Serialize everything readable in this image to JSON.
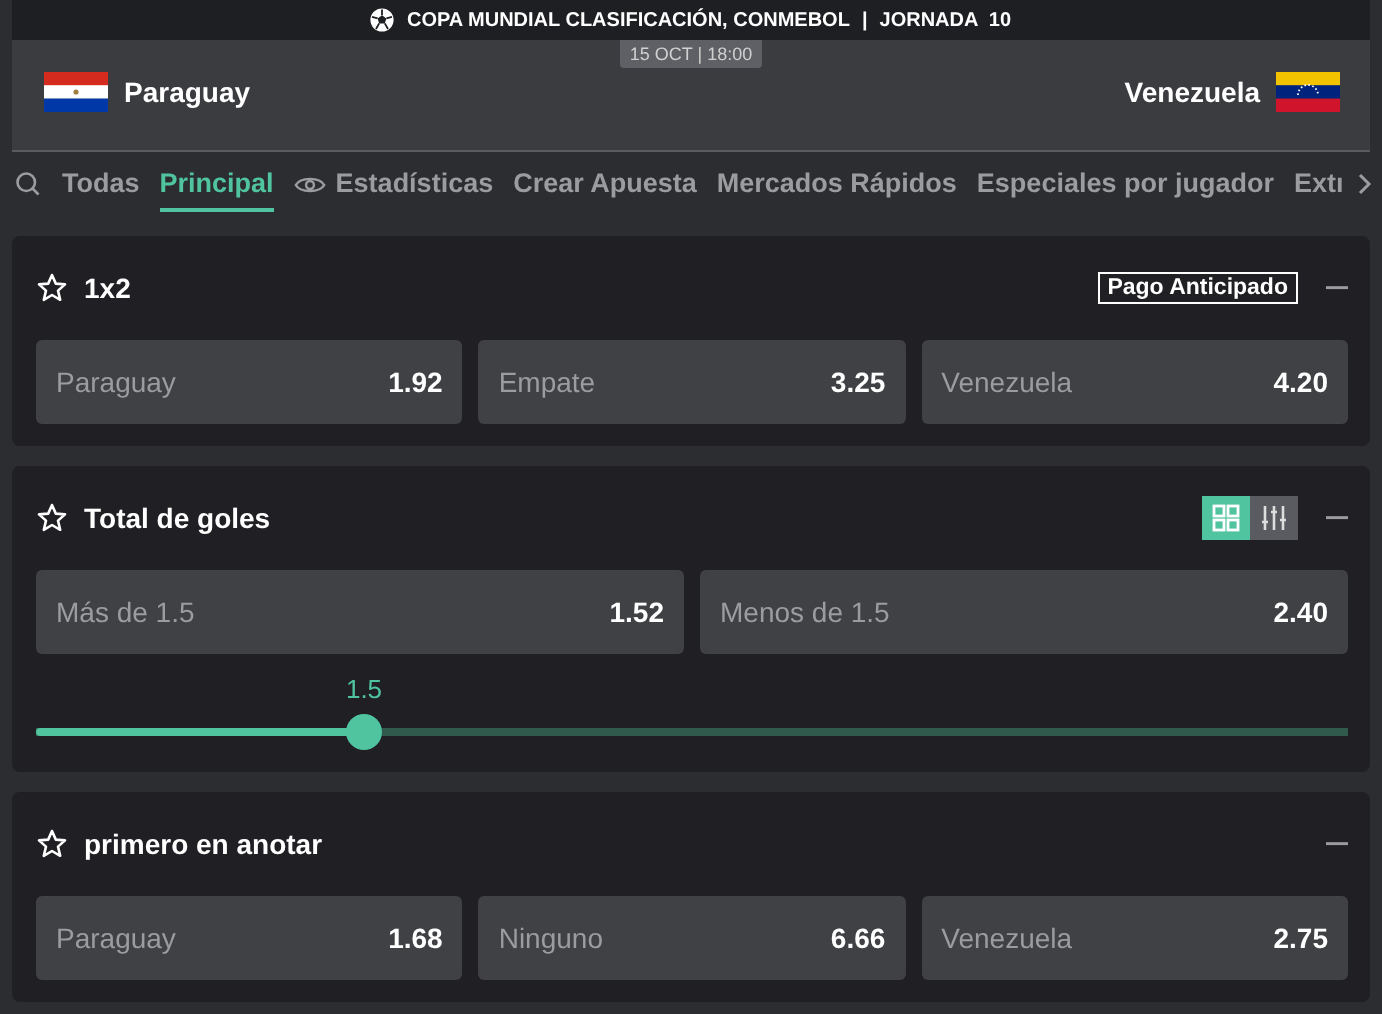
{
  "event": {
    "competition": "COPA MUNDIAL CLASIFICACIÓN, CONMEBOL",
    "separator": "|",
    "round": "JORNADA  10",
    "datetime": "15 OCT | 18:00",
    "home": "Paraguay",
    "away": "Venezuela"
  },
  "tabs": [
    {
      "label": "Todas",
      "selected": false,
      "kind": "plain"
    },
    {
      "label": "Principal",
      "selected": true,
      "kind": "plain"
    },
    {
      "label": "Estadísticas",
      "selected": false,
      "kind": "eye"
    },
    {
      "label": "Crear Apuesta",
      "selected": false,
      "kind": "plain"
    },
    {
      "label": "Mercados Rápidos",
      "selected": false,
      "kind": "plain"
    },
    {
      "label": "Especiales por jugador",
      "selected": false,
      "kind": "plain"
    },
    {
      "label": "Extı",
      "selected": false,
      "kind": "plain"
    }
  ],
  "markets": [
    {
      "title": "1x2",
      "badge": "Pago Anticipado",
      "odds": [
        {
          "label": "Paraguay",
          "price": "1.92"
        },
        {
          "label": "Empate",
          "price": "3.25"
        },
        {
          "label": "Venezuela",
          "price": "4.20"
        }
      ]
    },
    {
      "title": "Total de goles",
      "views": [
        {
          "kind": "grid",
          "selected": true
        },
        {
          "kind": "sliders",
          "selected": false
        }
      ],
      "odds": [
        {
          "label": "Más de 1.5",
          "price": "1.52"
        },
        {
          "label": "Menos de 1.5",
          "price": "2.40"
        }
      ],
      "slider": {
        "reading": "1.5",
        "level": 0.25
      }
    },
    {
      "title": "primero en anotar",
      "odds": [
        {
          "label": "Paraguay",
          "price": "1.68"
        },
        {
          "label": "Ninguno",
          "price": "6.66"
        },
        {
          "label": "Venezuela",
          "price": "2.75"
        }
      ]
    }
  ]
}
